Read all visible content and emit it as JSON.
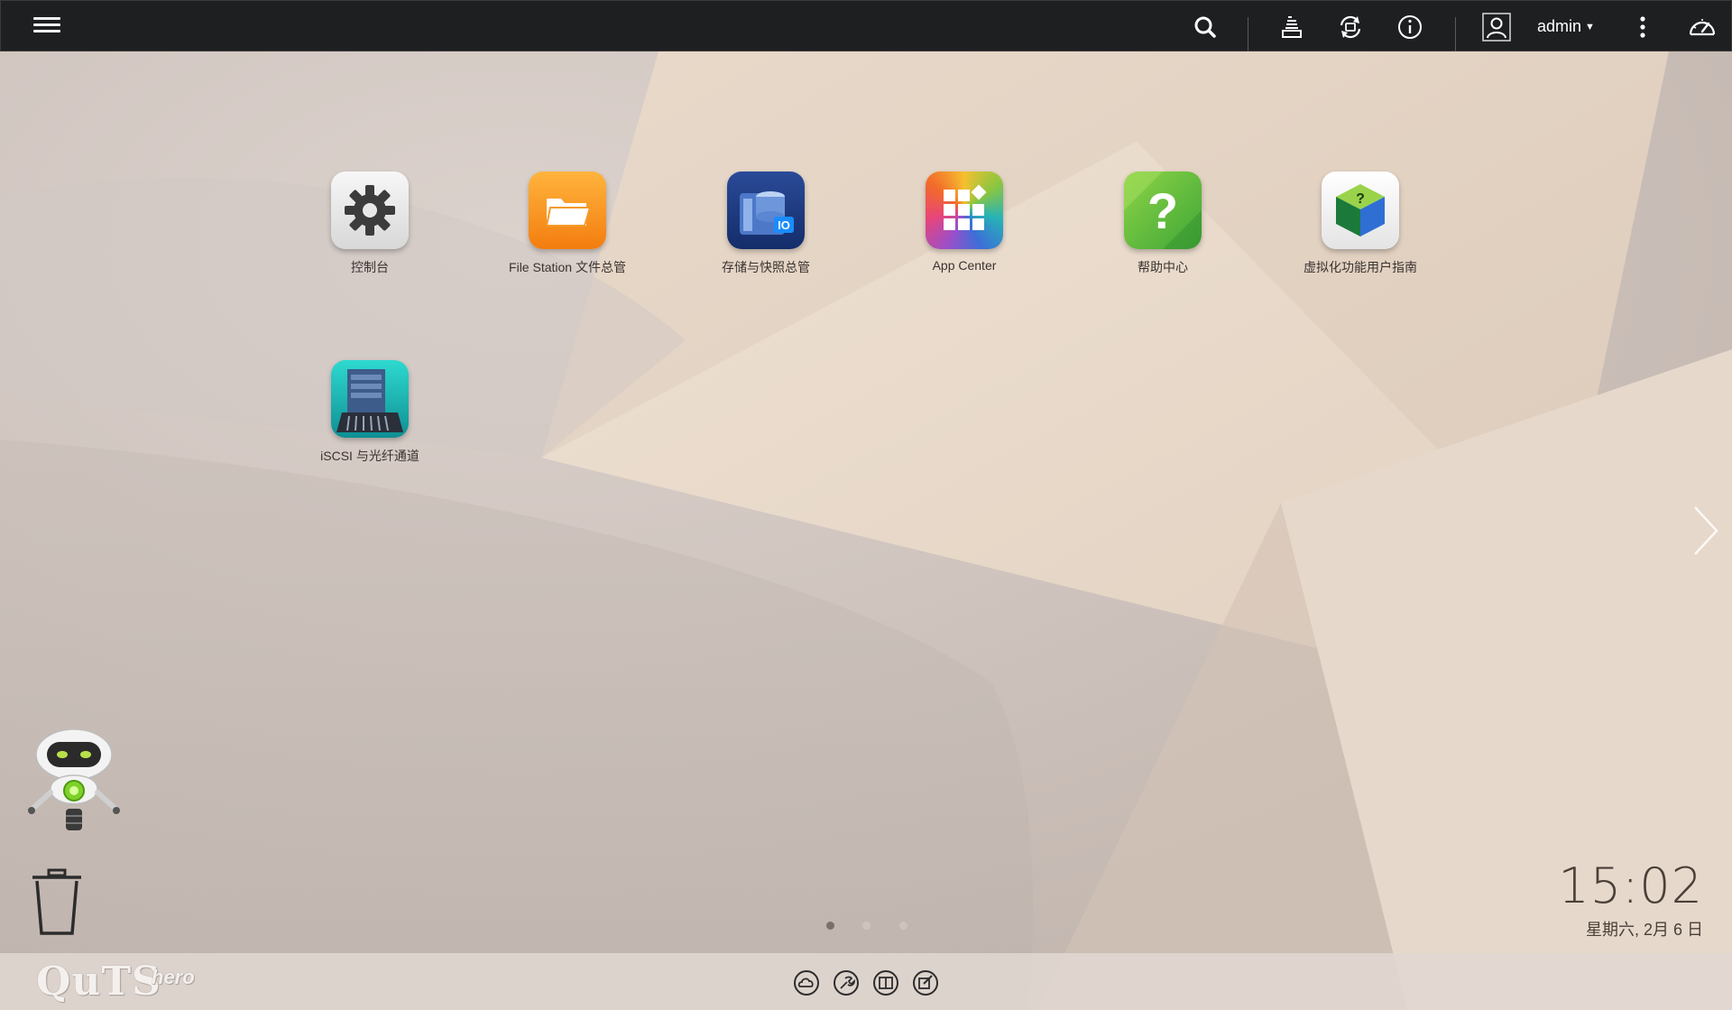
{
  "topbar": {
    "user": "admin",
    "icons": [
      "menu-icon",
      "search-icon",
      "task-stack-icon",
      "sync-icon",
      "info-icon",
      "user-icon",
      "more-icon",
      "dashboard-gauge-icon"
    ]
  },
  "desktop": {
    "apps": [
      {
        "label": "控制台",
        "icon": "gear-icon"
      },
      {
        "label": "File Station 文件总管",
        "icon": "folder-icon"
      },
      {
        "label": "存储与快照总管",
        "icon": "storage-icon"
      },
      {
        "label": "App Center",
        "icon": "app-grid-icon"
      },
      {
        "label": "帮助中心",
        "icon": "help-icon"
      },
      {
        "label": "虚拟化功能用户指南",
        "icon": "virtualization-cube-icon"
      },
      {
        "label": "iSCSI 与光纤通道",
        "icon": "iscsi-server-icon"
      }
    ],
    "pages": 3,
    "current_page": 1
  },
  "clock": {
    "time": "15:02",
    "date": "星期六, 2月 6 日"
  },
  "taskbar": {
    "brand": "QuTS",
    "brand_sub": "hero",
    "dock_icons": [
      "cloud-icon",
      "tools-icon",
      "book-icon",
      "edit-icon"
    ]
  },
  "colors": {
    "topbar_bg": "#1e1f21",
    "desktop_text": "#3a3330",
    "folder_orange": "#f7931e",
    "help_green": "#6dc23b",
    "iscsi_teal": "#1bb8b0"
  }
}
